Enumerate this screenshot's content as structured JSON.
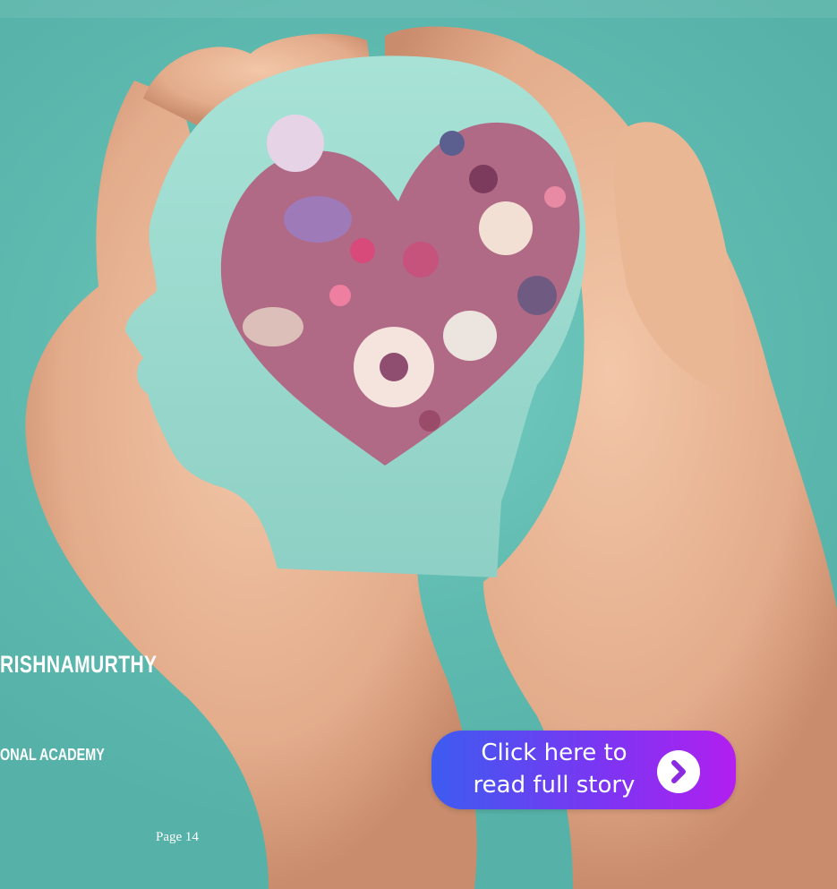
{
  "author": {
    "name": "RISHNAMURTHY"
  },
  "affiliation": {
    "text": "ONAL ACADEMY"
  },
  "footer": {
    "page": "Page 14"
  },
  "cta": {
    "line1": "Click here to",
    "line2": "read full story",
    "icon": "chevron-right-icon"
  },
  "image": {
    "icon": "head-with-floral-heart-photo"
  },
  "colors": {
    "background": "#62bcb2",
    "cta_gradient_start": "#3d5cf0",
    "cta_gradient_end": "#b21ff0",
    "cta_icon": "#8a2be2"
  }
}
